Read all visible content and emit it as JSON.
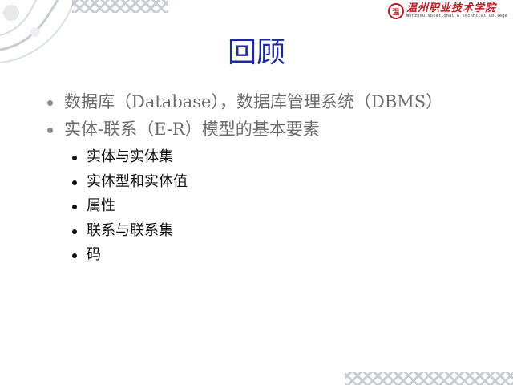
{
  "logo": {
    "seal": "温",
    "name_cn": "温州职业技术学院",
    "name_en": "Wenzhou Vocational & Technical College"
  },
  "slide": {
    "title": "回顾",
    "bullets": [
      "数据库（Database），数据库管理系统（DBMS）",
      "实体-联系（E-R）模型的基本要素"
    ],
    "sub_bullets": [
      "实体与实体集",
      "实体型和实体值",
      "属性",
      "联系与联系集",
      "码"
    ]
  },
  "colors": {
    "title": "#1f2a9a",
    "bullet_text": "#6b6b6b",
    "sub_bullet_text": "#111111",
    "logo": "#b81c22"
  }
}
